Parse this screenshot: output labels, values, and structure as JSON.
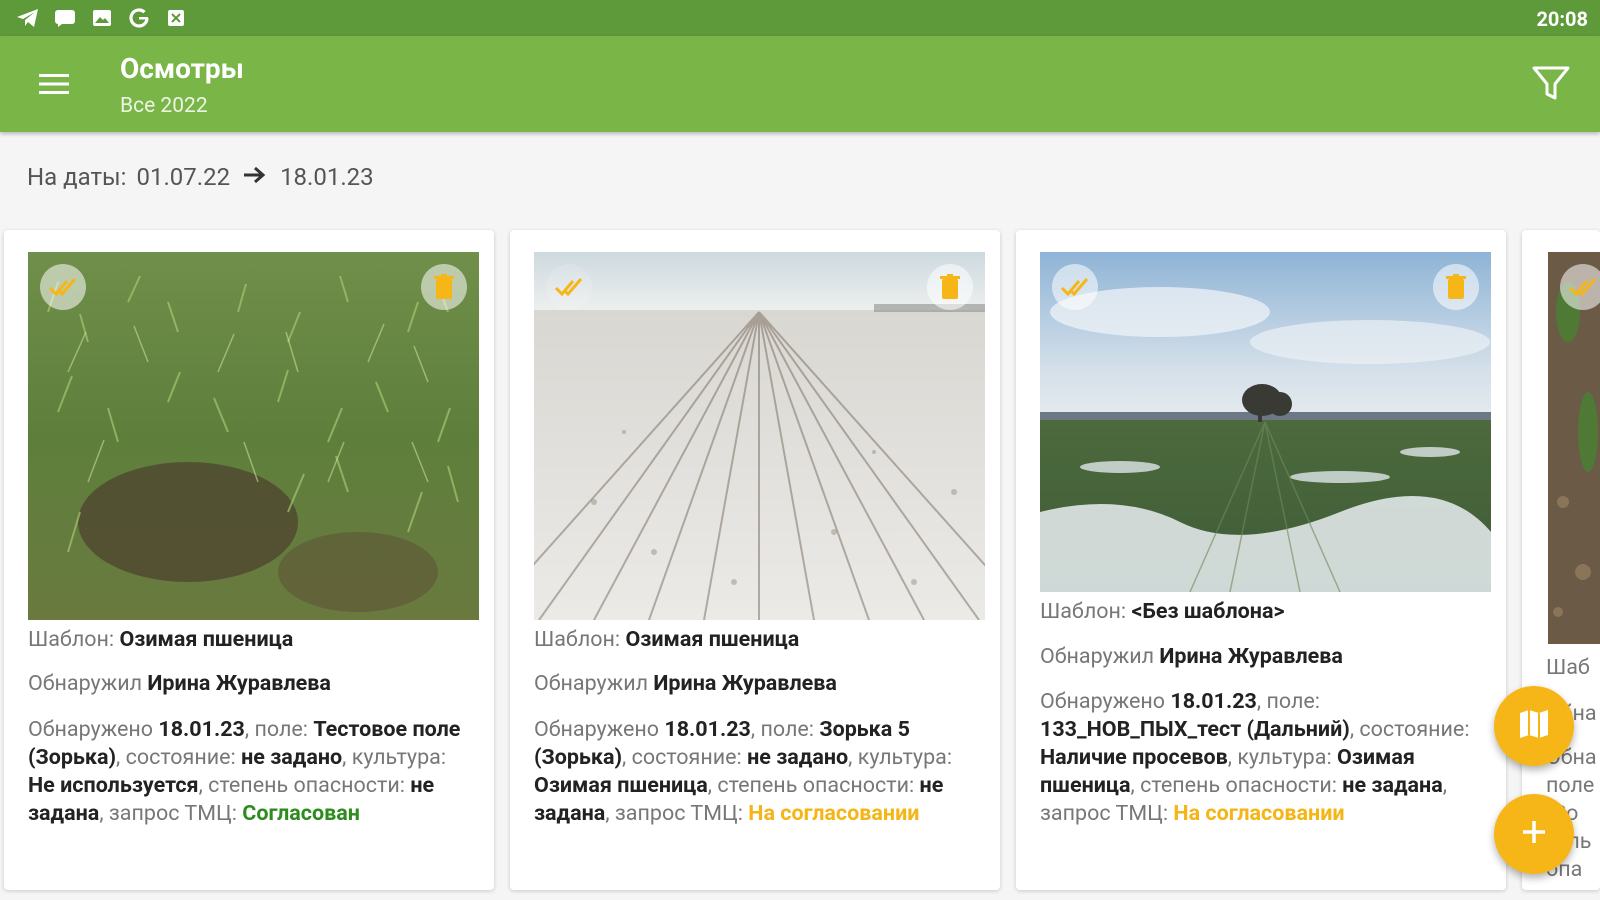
{
  "status_bar": {
    "time": "20:08",
    "icons": [
      "telegram-icon",
      "message-icon",
      "image-icon",
      "google-icon",
      "notification-icon"
    ]
  },
  "app_bar": {
    "title": "Осмотры",
    "subtitle": "Все 2022"
  },
  "date_range": {
    "label": "На даты:",
    "from": "01.07.22",
    "to": "18.01.23"
  },
  "cards": [
    {
      "template_label": "Шаблон: ",
      "template_value": "Озимая пшеница",
      "found_by_label": "Обнаружил ",
      "found_by_value": "Ирина Журавлева",
      "detected_label": "Обнаружено ",
      "date": "18.01.23",
      "field_label": ", поле: ",
      "field": "Тестовое поле (Зорька)",
      "state_label": ", состояние: ",
      "state": "не задано",
      "crop_label": ", культура: ",
      "crop": "Не используется",
      "danger_label": ", степень опасности: ",
      "danger": "не задана",
      "request_label": ", запрос ТМЦ: ",
      "request_status": "Согласован",
      "request_type": "ok"
    },
    {
      "template_label": "Шаблон: ",
      "template_value": "Озимая пшеница",
      "found_by_label": "Обнаружил ",
      "found_by_value": "Ирина Журавлева",
      "detected_label": "Обнаружено ",
      "date": "18.01.23",
      "field_label": ", поле: ",
      "field": "Зорька 5 (Зорька)",
      "state_label": ", состояние: ",
      "state": "не задано",
      "crop_label": ", культура: ",
      "crop": "Озимая пшеница",
      "danger_label": ", степень опасности: ",
      "danger": "не задана",
      "request_label": ", запрос ТМЦ: ",
      "request_status": "На согласовании",
      "request_type": "pending"
    },
    {
      "template_label": "Шаблон: ",
      "template_value": "<Без шаблона>",
      "found_by_label": "Обнаружил ",
      "found_by_value": "Ирина Журавлева",
      "detected_label": "Обнаружено ",
      "date": "18.01.23",
      "field_label": ", поле: ",
      "field": "133_НОВ_ПЫХ_тест (Дальний)",
      "state_label": ", состояние: ",
      "state": "Наличие просевов",
      "crop_label": ", культура: ",
      "crop": "Озимая пшеница",
      "danger_label": ", степень опасности: ",
      "danger": "не задана",
      "request_label": ", запрос ТМЦ: ",
      "request_status": "На согласовании",
      "request_type": "pending"
    }
  ],
  "partial_card": {
    "template_label_fragment": "Шаб",
    "line2_fragment": "Обна",
    "line3_fragment": "Обна",
    "line4_fragment": "поле",
    "line5_fragment": "(Зо",
    "line6_fragment": "куль",
    "line7_fragment": "опа"
  },
  "colors": {
    "status_bar": "#5e9a3a",
    "app_bar": "#7ab547",
    "accent": "#f7b618",
    "approved": "#2e8b1e",
    "pending": "#f6b516"
  }
}
